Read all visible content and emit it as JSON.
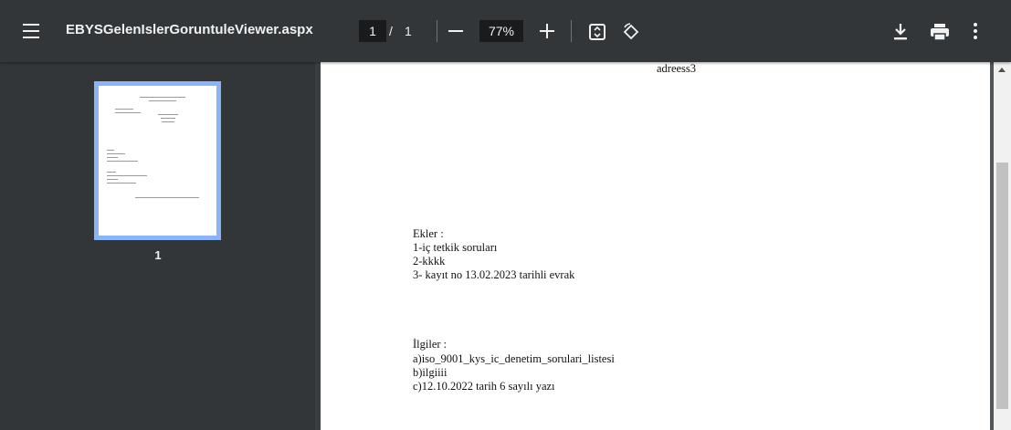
{
  "toolbar": {
    "title": "EBYSGelenIslerGoruntuleViewer.aspx",
    "current_page": "1",
    "page_separator": "/",
    "total_pages": "1",
    "zoom": "77%",
    "icons": [
      "menu-icon",
      "zoom-out-icon",
      "zoom-in-icon",
      "fit-page-icon",
      "rotate-icon",
      "download-icon",
      "print-icon",
      "more-options-icon"
    ]
  },
  "sidebar": {
    "thumbnail_label": "1"
  },
  "document": {
    "header_text": "adreess3",
    "ekler_heading": "Ekler :",
    "ekler": [
      "1-iç tetkik soruları",
      "2-kkkk",
      "3- kayıt no 13.02.2023 tarihli evrak"
    ],
    "ilgiler_heading": "İlgiler :",
    "ilgiler": [
      "a)iso_9001_kys_ic_denetim_sorulari_listesi",
      "b)ilgiiii",
      "c)12.10.2022 tarih 6 sayılı yazı"
    ]
  },
  "colors": {
    "toolbar_bg": "#323639",
    "viewer_bg": "#525659",
    "thumbnail_border": "#8ab4f8"
  }
}
